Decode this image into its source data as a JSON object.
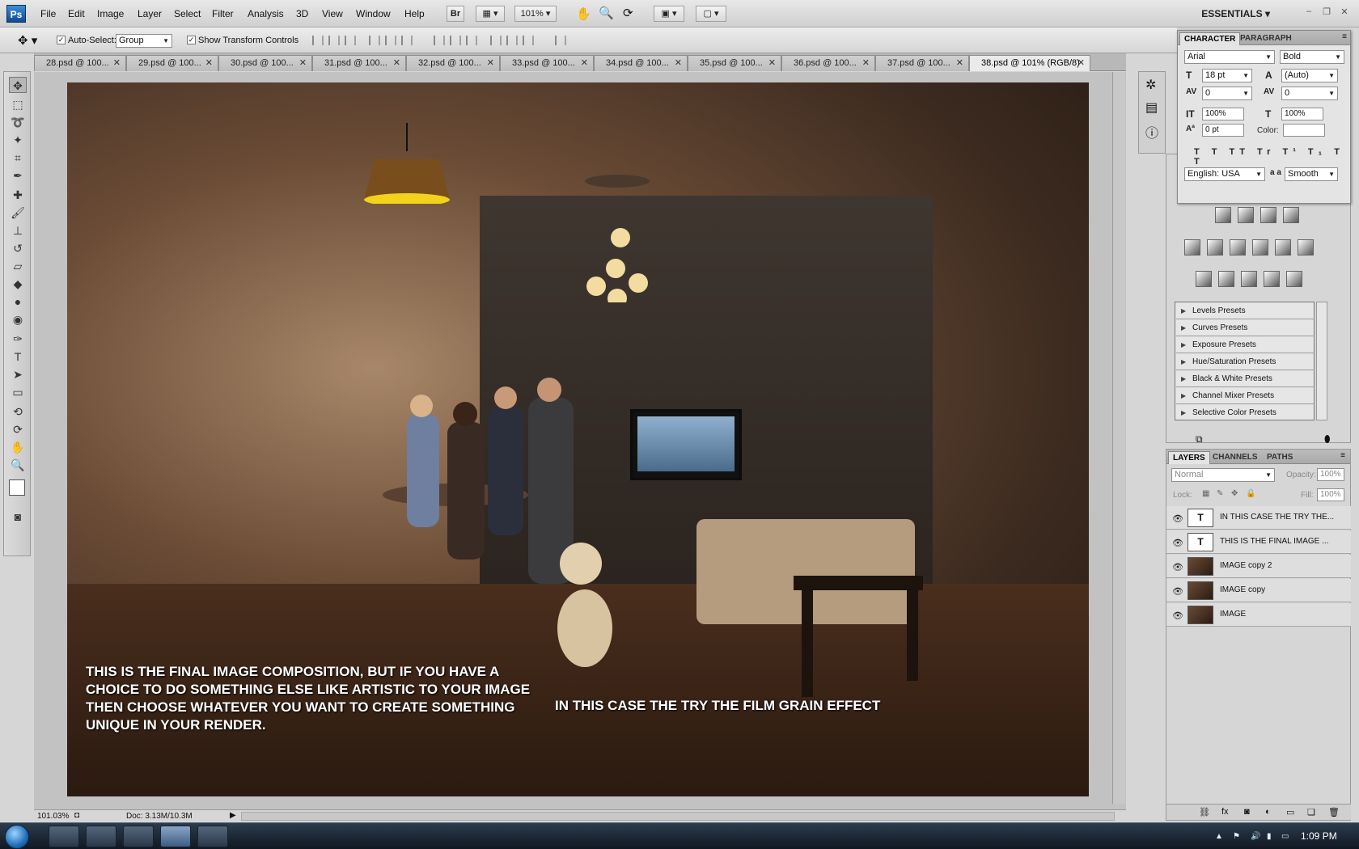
{
  "menubar": {
    "logo": "Ps",
    "items": [
      "File",
      "Edit",
      "Image",
      "Layer",
      "Select",
      "Filter",
      "Analysis",
      "3D",
      "View",
      "Window",
      "Help"
    ],
    "bridge_label": "Br",
    "zoom_value": "101%",
    "workspace": "ESSENTIALS"
  },
  "options_bar": {
    "auto_select_label": "Auto-Select:",
    "auto_select_value": "Group",
    "show_transform_label": "Show Transform Controls"
  },
  "tabs": [
    {
      "label": "28.psd @ 100..."
    },
    {
      "label": "29.psd @ 100..."
    },
    {
      "label": "30.psd @ 100..."
    },
    {
      "label": "31.psd @ 100..."
    },
    {
      "label": "32.psd @ 100..."
    },
    {
      "label": "33.psd @ 100..."
    },
    {
      "label": "34.psd @ 100..."
    },
    {
      "label": "35.psd @ 100..."
    },
    {
      "label": "36.psd @ 100..."
    },
    {
      "label": "37.psd @ 100..."
    },
    {
      "label": "38.psd @ 101% (RGB/8)"
    }
  ],
  "canvas": {
    "text_left": "THIS IS THE FINAL IMAGE COMPOSITION, BUT IF YOU HAVE A CHOICE TO DO SOMETHING ELSE LIKE ARTISTIC TO YOUR IMAGE THEN CHOOSE WHATEVER YOU WANT TO CREATE SOMETHING UNIQUE IN YOUR RENDER.",
    "text_right": "IN THIS CASE THE TRY THE FILM GRAIN EFFECT"
  },
  "status": {
    "zoom": "101.03%",
    "doc": "Doc: 3.13M/10.3M"
  },
  "character_panel": {
    "tabs": [
      "CHARACTER",
      "PARAGRAPH"
    ],
    "font_family": "Arial",
    "font_style": "Bold",
    "size": "18 pt",
    "leading": "(Auto)",
    "kerning": "0",
    "tracking": "0",
    "vscale": "100%",
    "hscale": "100%",
    "baseline": "0 pt",
    "color_label": "Color:",
    "language": "English: USA",
    "aa_label": "a a",
    "antialias": "Smooth"
  },
  "presets": [
    "Levels Presets",
    "Curves Presets",
    "Exposure Presets",
    "Hue/Saturation Presets",
    "Black & White Presets",
    "Channel Mixer Presets",
    "Selective Color Presets"
  ],
  "layers_panel": {
    "tabs": [
      "LAYERS",
      "CHANNELS",
      "PATHS"
    ],
    "blend_mode": "Normal",
    "opacity_label": "Opacity:",
    "opacity_value": "100%",
    "lock_label": "Lock:",
    "fill_label": "Fill:",
    "fill_value": "100%",
    "layers": [
      {
        "name": "IN THIS CASE THE TRY THE...",
        "type": "text"
      },
      {
        "name": "THIS IS THE FINAL IMAGE ...",
        "type": "text"
      },
      {
        "name": "IMAGE copy 2",
        "type": "image"
      },
      {
        "name": "IMAGE copy",
        "type": "image"
      },
      {
        "name": "IMAGE",
        "type": "image"
      }
    ]
  },
  "taskbar": {
    "clock": "1:09 PM"
  }
}
